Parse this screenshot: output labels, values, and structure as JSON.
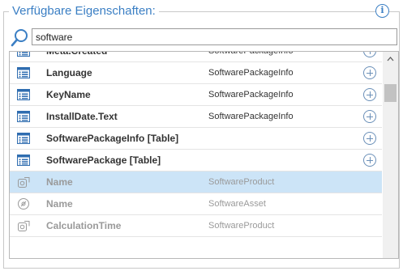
{
  "panel": {
    "title": "Verfügbare Eigenschaften:",
    "info_glyph": "i"
  },
  "search": {
    "value": "software"
  },
  "rows": [
    {
      "name": "Meta.Created",
      "source": "SoftwarePackageInfo",
      "icon": "property-table-icon",
      "muted": false,
      "selected": false,
      "addable": true
    },
    {
      "name": "Language",
      "source": "SoftwarePackageInfo",
      "icon": "property-table-icon",
      "muted": false,
      "selected": false,
      "addable": true
    },
    {
      "name": "KeyName",
      "source": "SoftwarePackageInfo",
      "icon": "property-table-icon",
      "muted": false,
      "selected": false,
      "addable": true
    },
    {
      "name": "InstallDate.Text",
      "source": "SoftwarePackageInfo",
      "icon": "property-table-icon",
      "muted": false,
      "selected": false,
      "addable": true
    },
    {
      "name": "SoftwarePackageInfo [Table]",
      "source": "",
      "icon": "property-table-icon",
      "muted": false,
      "selected": false,
      "addable": true
    },
    {
      "name": "SoftwarePackage [Table]",
      "source": "",
      "icon": "property-table-icon",
      "muted": false,
      "selected": false,
      "addable": true
    },
    {
      "name": "Name",
      "source": "SoftwareProduct",
      "icon": "software-product-icon",
      "muted": true,
      "selected": true,
      "addable": false
    },
    {
      "name": "Name",
      "source": "SoftwareAsset",
      "icon": "software-asset-icon",
      "muted": true,
      "selected": false,
      "addable": false
    },
    {
      "name": "CalculationTime",
      "source": "SoftwareProduct",
      "icon": "software-product-icon",
      "muted": true,
      "selected": false,
      "addable": false
    }
  ],
  "colors": {
    "accent": "#3b7fc4",
    "selected_row": "#cce4f7",
    "muted_text": "#9a9a9a"
  }
}
